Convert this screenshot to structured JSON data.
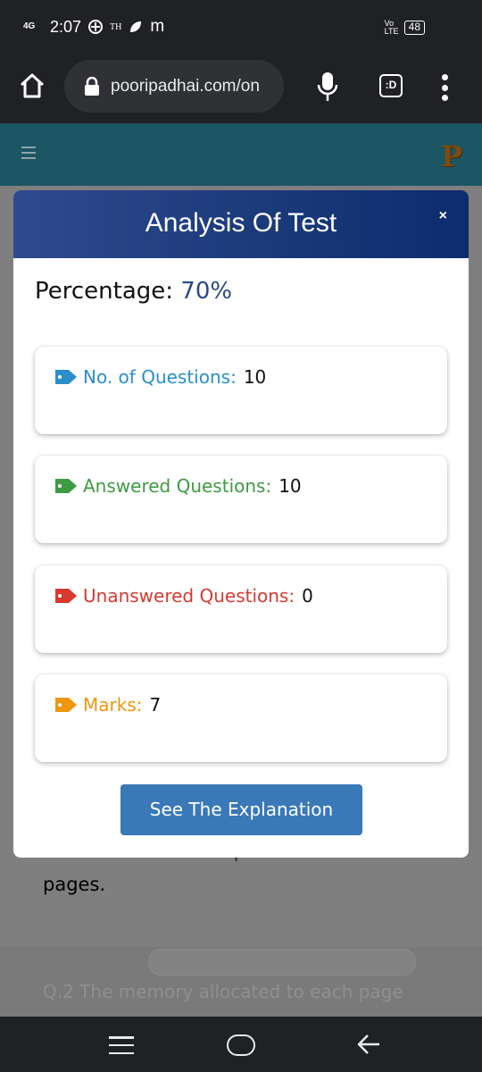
{
  "status_bar": {
    "network": "4G",
    "time": "2:07",
    "indicators": [
      "TH",
      "m"
    ],
    "volte": "Vo LTE",
    "battery": "48"
  },
  "browser": {
    "url": "pooripadhai.com/on",
    "tab_label": ":D",
    "icons": [
      "home-icon",
      "lock-icon",
      "mic-icon",
      "tab-switcher-icon",
      "more-vert-icon"
    ]
  },
  "site": {
    "logo": "P"
  },
  "modal": {
    "title": "Analysis Of Test",
    "close": "×",
    "percentage_label": "Percentage:",
    "percentage_value": "70%",
    "stats": [
      {
        "label": "No. of Questions:",
        "value": "10",
        "color": "#2a8fc9"
      },
      {
        "label": "Answered Questions:",
        "value": "10",
        "color": "#3f9a44"
      },
      {
        "label": "Unanswered Questions:",
        "value": "0",
        "color": "#d63a2f"
      },
      {
        "label": "Marks:",
        "value": "7",
        "color": "#f0960c"
      }
    ],
    "button": "See The Explanation"
  },
  "background": {
    "tail_text": "pages.",
    "comma": ",",
    "next_question": "Q.2 The memory allocated to each page"
  }
}
